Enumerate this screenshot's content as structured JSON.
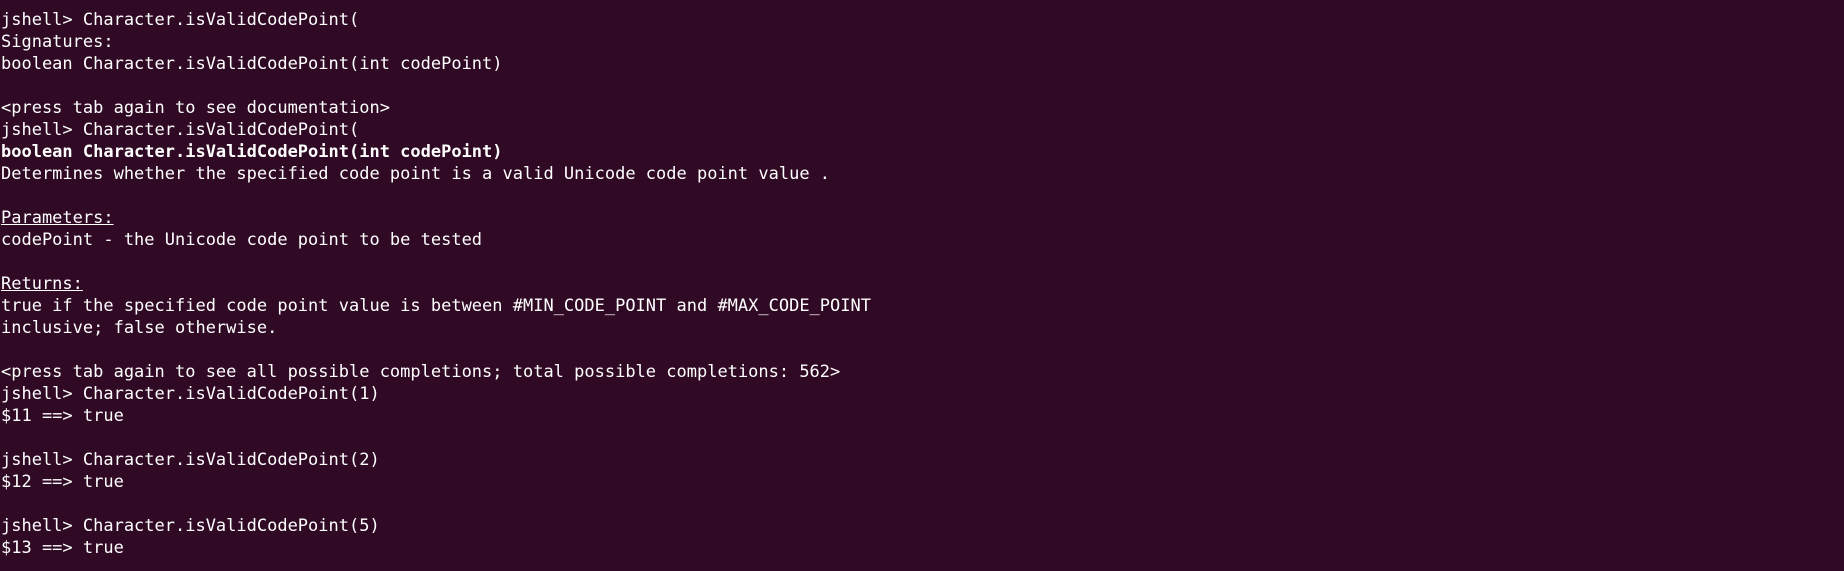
{
  "terminal": {
    "lines": [
      {
        "text": "jshell> Character.isValidCodePoint(",
        "style": ""
      },
      {
        "text": "Signatures:",
        "style": ""
      },
      {
        "text": "boolean Character.isValidCodePoint(int codePoint)",
        "style": ""
      },
      {
        "text": "",
        "style": ""
      },
      {
        "text": "<press tab again to see documentation>",
        "style": ""
      },
      {
        "text": "jshell> Character.isValidCodePoint(",
        "style": ""
      },
      {
        "text": "boolean Character.isValidCodePoint(int codePoint)",
        "style": "bold"
      },
      {
        "text": "Determines whether the specified code point is a valid Unicode code point value .",
        "style": ""
      },
      {
        "text": "",
        "style": ""
      },
      {
        "text": "Parameters:",
        "style": "underline"
      },
      {
        "text": "codePoint - the Unicode code point to be tested",
        "style": ""
      },
      {
        "text": "",
        "style": ""
      },
      {
        "text": "Returns:",
        "style": "underline"
      },
      {
        "text": "true if the specified code point value is between #MIN_CODE_POINT and #MAX_CODE_POINT",
        "style": ""
      },
      {
        "text": "inclusive; false otherwise.",
        "style": ""
      },
      {
        "text": "",
        "style": ""
      },
      {
        "text": "<press tab again to see all possible completions; total possible completions: 562>",
        "style": ""
      },
      {
        "text": "jshell> Character.isValidCodePoint(1)",
        "style": ""
      },
      {
        "text": "$11 ==> true",
        "style": ""
      },
      {
        "text": "",
        "style": ""
      },
      {
        "text": "jshell> Character.isValidCodePoint(2)",
        "style": ""
      },
      {
        "text": "$12 ==> true",
        "style": ""
      },
      {
        "text": "",
        "style": ""
      },
      {
        "text": "jshell> Character.isValidCodePoint(5)",
        "style": ""
      },
      {
        "text": "$13 ==> true",
        "style": ""
      }
    ]
  },
  "colors": {
    "background": "#300a24",
    "foreground": "#ffffff"
  }
}
